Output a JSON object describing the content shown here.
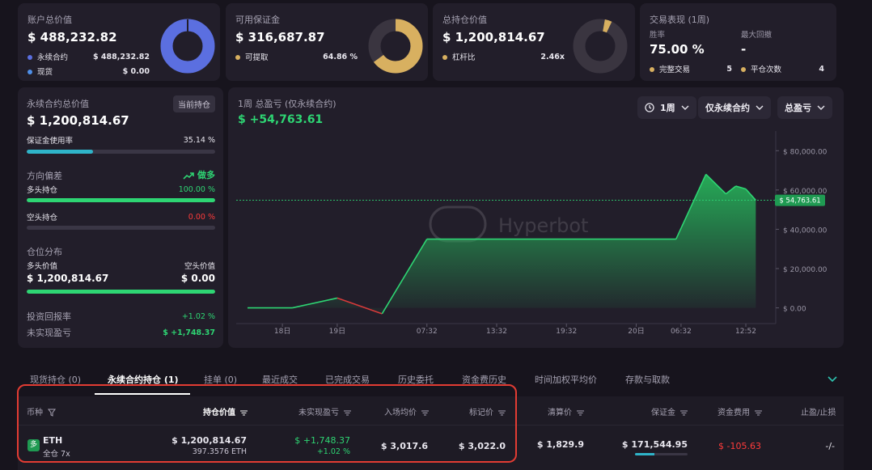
{
  "summary": {
    "account": {
      "title": "账户总价值",
      "value": "$ 488,232.82",
      "rows": [
        {
          "label": "永续合约",
          "value": "$ 488,232.82",
          "color": "#5b6fe0"
        },
        {
          "label": "现货",
          "value": "$ 0.00",
          "color": "#4f8fe8"
        }
      ]
    },
    "margin": {
      "title": "可用保证金",
      "value": "$ 316,687.87",
      "rows": [
        {
          "label": "可提取",
          "value": "64.86 %",
          "color": "#d8b060"
        }
      ]
    },
    "holdings": {
      "title": "总持仓价值",
      "value": "$ 1,200,814.67",
      "rows": [
        {
          "label": "杠杆比",
          "value": "2.46x",
          "color": "#d8b060"
        }
      ]
    },
    "trading": {
      "title": "交易表现 (1周)",
      "winrate_label": "胜率",
      "winrate": "75.00 %",
      "drawdown_label": "最大回撤",
      "drawdown": "-",
      "completed_label": "完整交易",
      "completed": "5",
      "close_label": "平仓次数",
      "close": "4"
    }
  },
  "perp_panel": {
    "title": "永续合约总价值",
    "badge": "当前持仓",
    "value": "$ 1,200,814.67",
    "margin_usage_label": "保证金使用率",
    "margin_usage": "35.14 %",
    "margin_usage_fraction": 0.3514,
    "bias_label": "方向偏差",
    "bias_value": "做多",
    "long_label": "多头持仓",
    "long_pct": "100.00 %",
    "long_fraction": 1.0,
    "short_label": "空头持仓",
    "short_pct": "0.00 %",
    "short_fraction": 0.0,
    "dist_label": "仓位分布",
    "long_value_label": "多头价值",
    "long_value": "$ 1,200,814.67",
    "short_value_label": "空头价值",
    "short_value": "$ 0.00",
    "roi_label": "投资回报率",
    "roi": "+1.02 %",
    "upnl_label": "未实现盈亏",
    "upnl": "$ +1,748.37"
  },
  "pnl_chart": {
    "title": "1周 总盈亏 (仅永续合约)",
    "value": "$ +54,763.61",
    "controls": {
      "period": "1周",
      "scope": "仅永续合约",
      "metric": "总盈亏"
    },
    "watermark": "Hyperbot"
  },
  "chart_data": {
    "type": "area",
    "title": "1周 总盈亏 (仅永续合约)",
    "y_ticks": [
      "$ 80,000.00",
      "$ 60,000.00",
      "$ 40,000.00",
      "$ 20,000.00",
      "$ 0.00"
    ],
    "x_ticks": [
      "18日",
      "19日",
      "07:32",
      "13:32",
      "19:32",
      "20日",
      "06:32",
      "12:52"
    ],
    "ylim": [
      -8000,
      90000
    ],
    "last_value_label": "$ 54,763.61",
    "last_value": 54763.61,
    "points": [
      [
        0,
        0
      ],
      [
        0.09,
        0
      ],
      [
        0.18,
        5000
      ],
      [
        0.27,
        -3000
      ],
      [
        0.36,
        35000
      ],
      [
        0.86,
        35000
      ],
      [
        0.92,
        68000
      ],
      [
        0.96,
        58000
      ],
      [
        0.98,
        62000
      ],
      [
        1.0,
        60500
      ],
      [
        1.02,
        54763.61
      ]
    ]
  },
  "tabs": [
    "现货持仓 (0)",
    "永续合约持仓 (1)",
    "挂单 (0)",
    "最近成交",
    "已完成交易",
    "历史委托",
    "资金费历史",
    "时间加权平均价",
    "存款与取款"
  ],
  "table": {
    "headers": [
      "币种",
      "持仓价值",
      "未实现盈亏",
      "入场均价",
      "标记价",
      "清算价",
      "保证金",
      "资金费用",
      "止盈/止损"
    ],
    "row": {
      "badge": "多",
      "coin": "ETH",
      "mode": "全仓 7x",
      "value": "$ 1,200,814.67",
      "qty": "397.3576 ETH",
      "upnl": "$ +1,748.37",
      "upnl_pct": "+1.02 %",
      "entry": "$ 3,017.6",
      "mark": "$ 3,022.0",
      "liq": "$ 1,829.9",
      "margin": "$ 171,544.95",
      "funding": "$ -105.63",
      "tpsl": "-/-"
    }
  }
}
